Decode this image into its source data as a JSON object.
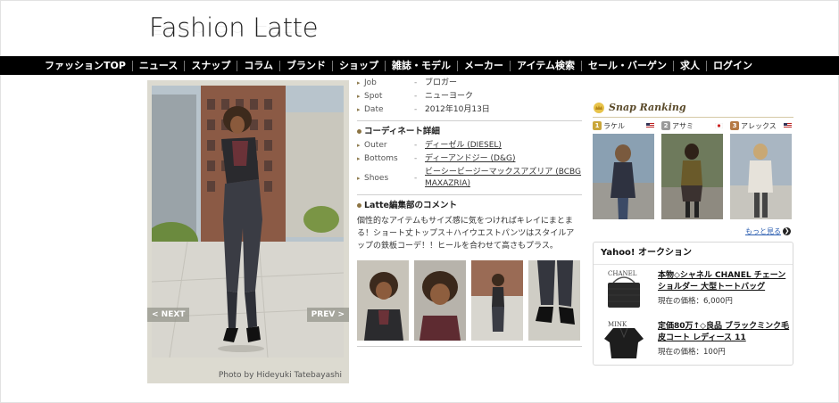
{
  "site": {
    "logo": "Fashion Latte"
  },
  "nav": [
    "ファッションTOP",
    "ニュース",
    "スナップ",
    "コラム",
    "ブランド",
    "ショップ",
    "雑誌・モデル",
    "メーカー",
    "アイテム検索",
    "セール・バーゲン",
    "求人",
    "ログイン"
  ],
  "photo": {
    "credit": "Photo by Hideyuki Tatebayashi",
    "next_label": "< NEXT",
    "prev_label": "PREV >"
  },
  "profile": {
    "job_label": "Job",
    "job_value": "ブロガー",
    "spot_label": "Spot",
    "spot_value": "ニューヨーク",
    "date_label": "Date",
    "date_value": "2012年10月13日"
  },
  "coordinate": {
    "heading": "コーディネート詳細",
    "items": [
      {
        "label": "Outer",
        "value": "ディーゼル (DIESEL)"
      },
      {
        "label": "Bottoms",
        "value": "ディーアンドジー (D&G)"
      },
      {
        "label": "Shoes",
        "value": "ビーシービージーマックスアズリア (BCBG MAXAZRIA)"
      }
    ]
  },
  "comment": {
    "heading": "Latte編集部のコメント",
    "text": "個性的なアイテムもサイズ感に気をつければキレイにまとまる！ショート丈トップス＋ハイウエストパンツはスタイルアップの鉄板コーデ！！ヒールを合わせて高さもプラス。"
  },
  "ranking": {
    "title": "Snap Ranking",
    "more_label": "もっと見る",
    "people": [
      {
        "rank": "1",
        "name": "ラケル",
        "rank_color": "#c9a63a"
      },
      {
        "rank": "2",
        "name": "アサミ",
        "rank_color": "#9a9a9a"
      },
      {
        "rank": "3",
        "name": "アレックス",
        "rank_color": "#b57a45"
      }
    ]
  },
  "auction": {
    "title": "Yahoo! オークション",
    "items": [
      {
        "brand": "CHANEL",
        "name": "本物◇シャネル CHANEL チェーンショルダー 大型トートバッグ",
        "price": "現在の価格：6,000円"
      },
      {
        "brand": "MINK",
        "name": "定価80万↑◇良品 ブラックミンク毛皮コート レディース 11",
        "price": "現在の価格：100円"
      }
    ]
  }
}
